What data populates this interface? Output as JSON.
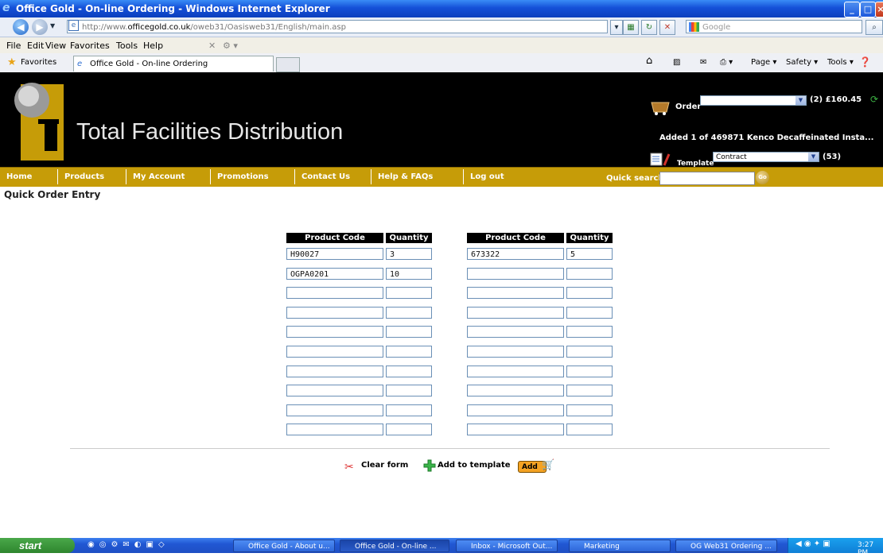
{
  "window": {
    "title": "Office Gold - On-line Ordering - Windows Internet Explorer"
  },
  "browser": {
    "address_url_prefix": "http://www.",
    "address_url_domain": "officegold.co.uk",
    "address_url_path": "/oweb31/Oasisweb31/English/main.asp",
    "search_placeholder": "Google",
    "menu": [
      "File",
      "Edit",
      "View",
      "Favorites",
      "Tools",
      "Help"
    ],
    "favorites_label": "Favorites",
    "tab_title": "Office Gold - On-line Ordering",
    "commands": [
      "Page ▾",
      "Safety ▾",
      "Tools ▾"
    ]
  },
  "site": {
    "brand": "Total Facilities Distribution",
    "order_label": "Order",
    "order_summary": "(2) £160.45",
    "added_message": "Added 1 of 469871 Kenco Decaffeinated Insta...",
    "template_label": "Template",
    "template_selected": "Contract",
    "template_count": "(53)",
    "nav": [
      "Home",
      "Products",
      "My Account",
      "Promotions",
      "Contact Us",
      "Help & FAQs",
      "Log out"
    ],
    "quick_search_label": "Quick search:",
    "go_label": "Go"
  },
  "quick_order": {
    "title": "Quick Order Entry",
    "col_product_code": "Product Code",
    "col_quantity": "Quantity",
    "left_rows": [
      {
        "code": "H90027",
        "qty": "3"
      },
      {
        "code": "OGPA0201",
        "qty": "10"
      },
      {
        "code": "",
        "qty": ""
      },
      {
        "code": "",
        "qty": ""
      },
      {
        "code": "",
        "qty": ""
      },
      {
        "code": "",
        "qty": ""
      },
      {
        "code": "",
        "qty": ""
      },
      {
        "code": "",
        "qty": ""
      },
      {
        "code": "",
        "qty": ""
      },
      {
        "code": "",
        "qty": ""
      }
    ],
    "right_rows": [
      {
        "code": "673322",
        "qty": "5"
      },
      {
        "code": "",
        "qty": ""
      },
      {
        "code": "",
        "qty": ""
      },
      {
        "code": "",
        "qty": ""
      },
      {
        "code": "",
        "qty": ""
      },
      {
        "code": "",
        "qty": ""
      },
      {
        "code": "",
        "qty": ""
      },
      {
        "code": "",
        "qty": ""
      },
      {
        "code": "",
        "qty": ""
      },
      {
        "code": "",
        "qty": ""
      }
    ],
    "clear_form_label": "Clear form",
    "add_to_template_label": "Add to template",
    "add_label": "Add"
  },
  "taskbar": {
    "start_label": "start",
    "items": [
      "Office Gold - About u...",
      "Office Gold - On-line ...",
      "Inbox - Microsoft Out...",
      "Marketing",
      "OG Web31 Ordering ..."
    ],
    "clock": "3:27 PM"
  },
  "colors": {
    "nav_gold": "#c69c08",
    "title_blue": "#1450d8",
    "taskbar_blue": "#2157d3"
  }
}
